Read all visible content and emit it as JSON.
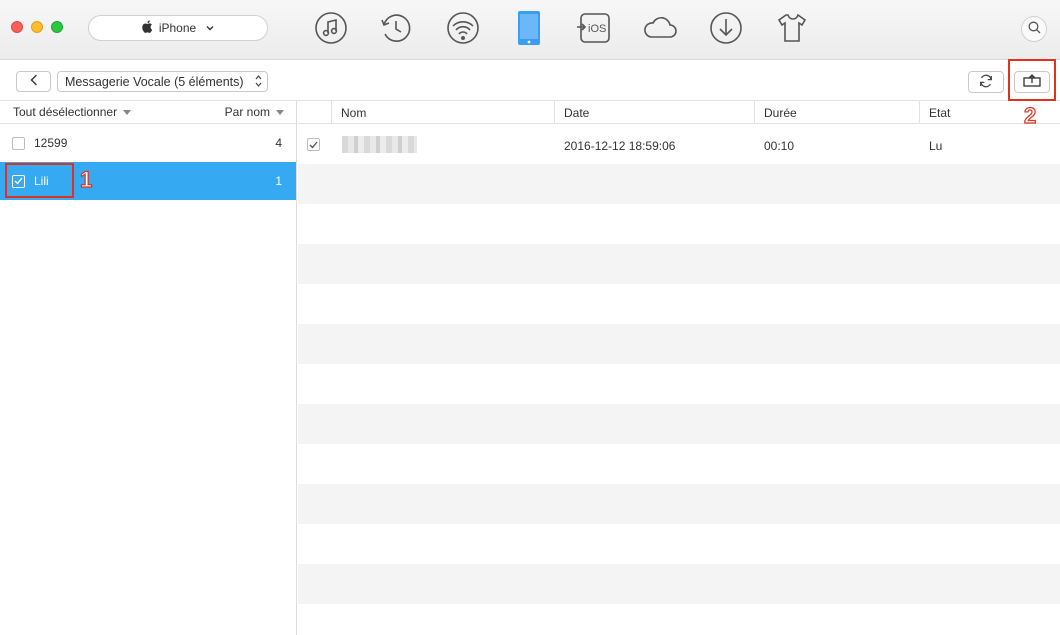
{
  "toolbar": {
    "device_name": "iPhone",
    "nav_icons": [
      "music-icon",
      "history-icon",
      "wifi-icon",
      "phone-icon",
      "to-ios-icon",
      "cloud-icon",
      "download-icon",
      "tshirt-icon"
    ],
    "to_ios_label": "iOS"
  },
  "subbar": {
    "category_label": "Messagerie Vocale (5 éléments)"
  },
  "left": {
    "select_toggle": "Tout désélectionner",
    "sort_label": "Par nom",
    "contacts": [
      {
        "name": "12599",
        "count": "4",
        "checked": false,
        "selected": false
      },
      {
        "name": "Lili",
        "count": "1",
        "checked": true,
        "selected": true
      }
    ]
  },
  "table": {
    "columns": {
      "name": "Nom",
      "date": "Date",
      "duration": "Durée",
      "status": "Etat"
    },
    "rows": [
      {
        "date": "2016-12-12 18:59:06",
        "duration": "00:10",
        "status": "Lu",
        "checked": true
      }
    ]
  },
  "annotations": {
    "step1": "1",
    "step2": "2"
  },
  "colors": {
    "selection": "#35a9f2",
    "active_icon": "#3c9cf0",
    "highlight": "#e0301e"
  }
}
